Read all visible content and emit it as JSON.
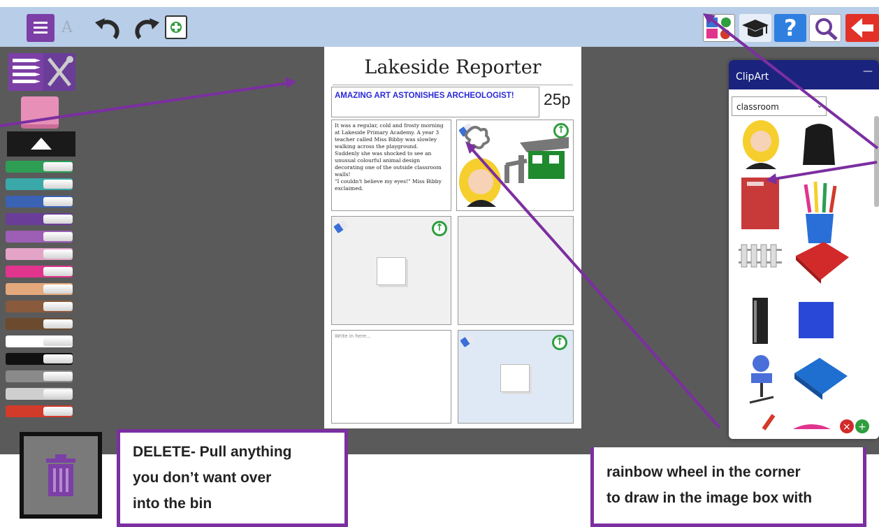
{
  "toolbar": {
    "menu_icon": "hamburger-menu-icon",
    "font_label": "A",
    "undo_icon": "undo-icon",
    "redo_icon": "redo-icon",
    "add_page_icon": "add-page-icon",
    "clipart_icon": "clipart-icon",
    "help_label": "?",
    "search_icon": "magnifier-icon",
    "exit_icon": "back-arrow-icon"
  },
  "newspaper": {
    "title": "Lakeside Reporter",
    "headline": "AMAZING ART ASTONISHES ARCHEOLOGIST!",
    "price": "25p",
    "story_lines": [
      "It was a regular, cold and frosty morning",
      "at Lakeside Primary Academy. A year 3",
      "teacher called Miss Bibby was slowley",
      "walking across the playground.",
      "Suddenly she was shocked to see an",
      "unusual colourful animal design",
      "decorating one of the outside classroom",
      "walls!",
      "\"I couldn't believe my eyes!\" Miss Bibby",
      "exclaimed."
    ],
    "text_placeholder": "Write in here..."
  },
  "clipart": {
    "title": "ClipArt",
    "minimize_label": "—",
    "category_value": "classroom",
    "items": [
      "girl",
      "backpack",
      "notebook",
      "pencil-pot",
      "abacus",
      "red-folder",
      "door",
      "grid-paper",
      "chair",
      "blue-folder",
      "pencil",
      "pencil-case"
    ]
  },
  "left_panel": {
    "marker_colors": [
      "#2e9e55",
      "#3aa8a8",
      "#3b63b3",
      "#6a3d99",
      "#9c5fb5",
      "#e3a4c8",
      "#e0348d",
      "#e3a97c",
      "#8a5a3c",
      "#6b4a2e",
      "#ffffff",
      "#111111",
      "#8a8a8a",
      "#cfcfcf",
      "#d23a2a"
    ]
  },
  "callouts": {
    "delete_text": "DELETE- Pull anything you don’t want over into the bin",
    "delete_lines": [
      "DELETE- Pull anything",
      "you don’t want over",
      "into the bin"
    ],
    "draw_lines": [
      "rainbow wheel in the corner",
      "to draw in the image box with"
    ]
  },
  "colors": {
    "toolbar_bg": "#b8cde8",
    "workspace_bg": "#5a5a5a",
    "accent_purple": "#7b2fa0",
    "clipart_header": "#1a237e"
  }
}
